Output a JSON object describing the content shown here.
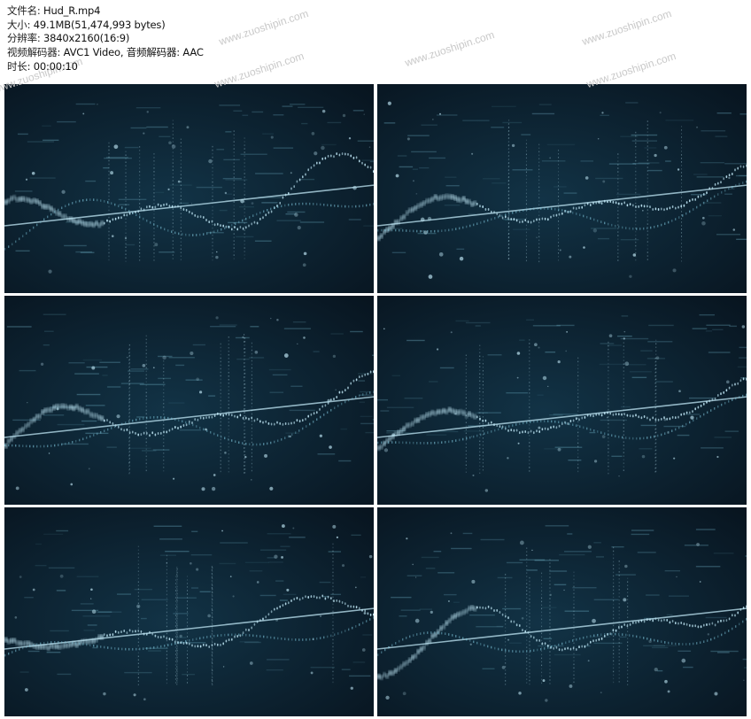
{
  "file_info": {
    "filename_label": "文件名: ",
    "filename": "Hud_R.mp4",
    "size_label": "大小: ",
    "size": "49.1MB(51,474,993 bytes)",
    "resolution_label": "分辨率: ",
    "resolution": "3840x2160(16:9)",
    "codec_label": "视频解码器: ",
    "codec": "AVC1 Video, 音频解码器: AAC",
    "duration_label": "时长: ",
    "duration": "00:00:10"
  },
  "watermark": "www.zuoshipin.com",
  "colors": {
    "background": "#ffffff",
    "frame_bg_dark": "#081520",
    "frame_bg_mid": "#123346",
    "glow": "#bfe6f4",
    "accent": "#7fc6dc"
  },
  "thumbnails": [
    {
      "seed": 1
    },
    {
      "seed": 2
    },
    {
      "seed": 3
    },
    {
      "seed": 4
    },
    {
      "seed": 5
    },
    {
      "seed": 6
    }
  ]
}
